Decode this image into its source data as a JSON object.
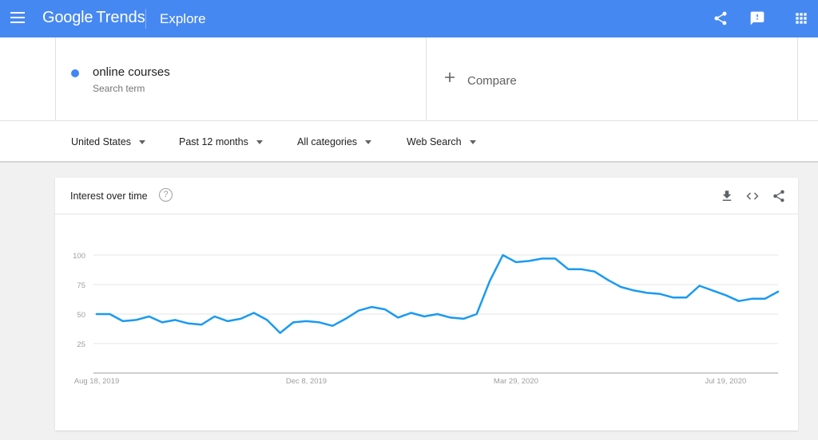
{
  "header": {
    "logo_google": "Google",
    "logo_trends": "Trends",
    "title": "Explore",
    "bg_color": "#4688f1",
    "icons": [
      "menu-icon",
      "share-icon",
      "feedback-icon",
      "apps-icon"
    ]
  },
  "search": {
    "term": "online courses",
    "term_sublabel": "Search term",
    "term_color": "#4285f4",
    "compare_label": "Compare"
  },
  "filters": {
    "region": "United States",
    "time": "Past 12 months",
    "category": "All categories",
    "property": "Web Search"
  },
  "card": {
    "title": "Interest over time",
    "help": "?",
    "icons": [
      "download-icon",
      "embed-icon",
      "share-icon"
    ]
  },
  "chart_data": {
    "type": "line",
    "title": "Interest over time",
    "xlabel": "",
    "ylabel": "",
    "ylim": [
      0,
      100
    ],
    "yticks": [
      25,
      50,
      75,
      100
    ],
    "grid": true,
    "line_color": "#1a9af1",
    "x_tick_labels": [
      {
        "index": 0,
        "label": "Aug 18, 2019"
      },
      {
        "index": 16,
        "label": "Dec 8, 2019"
      },
      {
        "index": 32,
        "label": "Mar 29, 2020"
      },
      {
        "index": 48,
        "label": "Jul 19, 2020"
      }
    ],
    "series": [
      {
        "values": [
          50,
          50,
          44,
          45,
          48,
          43,
          45,
          42,
          41,
          48,
          44,
          46,
          51,
          45,
          34,
          43,
          44,
          43,
          40,
          46,
          53,
          56,
          54,
          47,
          51,
          48,
          50,
          47,
          46,
          50,
          78,
          100,
          94,
          95,
          97,
          97,
          88,
          88,
          86,
          79,
          73,
          70,
          68,
          67,
          64,
          64,
          74,
          70,
          66,
          61,
          63,
          63,
          69
        ]
      }
    ]
  }
}
